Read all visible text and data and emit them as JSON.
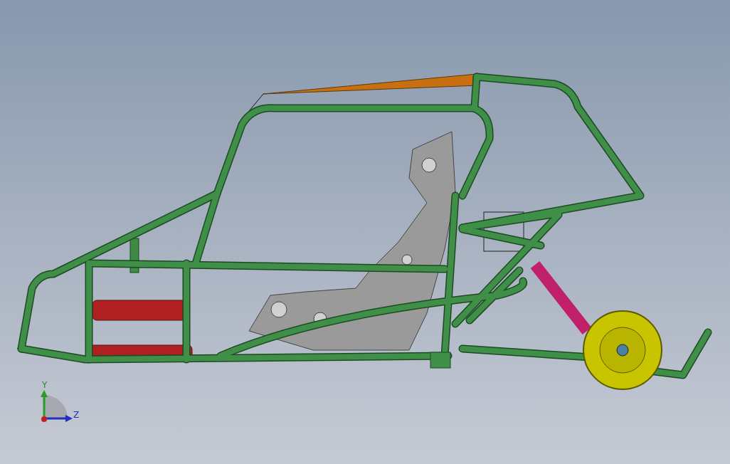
{
  "axes_triad": {
    "labels": [
      "Y",
      "Z"
    ]
  }
}
